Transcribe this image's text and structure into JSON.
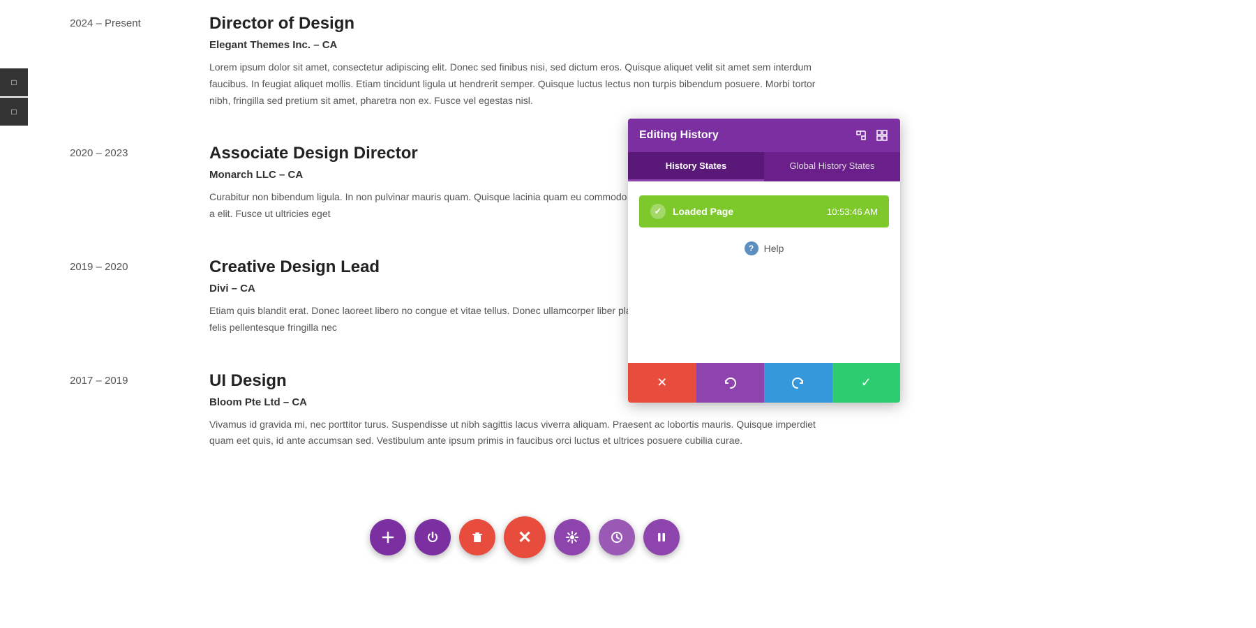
{
  "timeline": [
    {
      "years": "2024 – Present",
      "title": "Director of Design",
      "company": "Elegant Themes Inc. – CA",
      "description": "Lorem ipsum dolor sit amet, consectetur adipiscing elit. Donec sed finibus nisi, sed dictum eros. Quisque aliquet velit sit amet sem interdum faucibus. In feugiat aliquet mollis. Etiam tincidunt ligula ut hendrerit semper. Quisque luctus lectus non turpis bibendum posuere. Morbi tortor nibh, fringilla sed pretium sit amet, pharetra non ex. Fusce vel egestas nisl."
    },
    {
      "years": "2020 – 2023",
      "title": "Associate Design Director",
      "company": "Monarch LLC – CA",
      "description": "Curabitur non bibendum ligula. In non pulvinar mauris quam. Quisque lacinia quam eu commodo orci. Sed vitae nulla et justo pellentesque congu a elit. Fusce ut ultricies eget"
    },
    {
      "years": "2019 – 2020",
      "title": "Creative Design Lead",
      "company": "Divi – CA",
      "description": "Etiam quis blandit erat. Donec laoreet libero no congue et vitae tellus. Donec ullamcorper liber placerat eget, sollicitudin a sapien. Cras ut auct felis pellentesque fringilla nec"
    },
    {
      "years": "2017 – 2019",
      "title": "UI Design",
      "company": "Bloom Pte Ltd – CA",
      "description": "Vivamus id gravida mi, nec porttitor turus. Suspendisse ut nibh sagittis lacus viverra aliquam. Praesent ac lobortis mauris. Quisque imperdiet quam eet quis, id ante accumsan sed. Vestibulum ante ipsum primis in faucibus orci luctus et ultrices posuere cubilia curae."
    }
  ],
  "panel": {
    "title": "Editing History",
    "tabs": [
      {
        "label": "History States",
        "active": true
      },
      {
        "label": "Global History States",
        "active": false
      }
    ],
    "history_item": {
      "label": "Loaded Page",
      "time": "10:53:46 AM"
    },
    "help_text": "Help",
    "footer_buttons": [
      {
        "icon": "✕",
        "color": "red"
      },
      {
        "icon": "↺",
        "color": "purple"
      },
      {
        "icon": "↻",
        "color": "blue"
      },
      {
        "icon": "✓",
        "color": "green"
      }
    ]
  },
  "floating_toolbar": {
    "buttons": [
      {
        "icon": "+",
        "color": "purple-dark",
        "name": "add"
      },
      {
        "icon": "⏻",
        "color": "purple-dark",
        "name": "power"
      },
      {
        "icon": "🗑",
        "color": "red-btn",
        "name": "delete"
      },
      {
        "icon": "✕",
        "color": "close-btn",
        "name": "close"
      },
      {
        "icon": "⚙",
        "color": "settings-btn",
        "name": "settings"
      },
      {
        "icon": "🕐",
        "color": "history-btn",
        "name": "history"
      },
      {
        "icon": "⏸",
        "color": "pause-btn",
        "name": "pause"
      }
    ]
  },
  "sidebar": {
    "buttons": [
      "□",
      "□"
    ]
  }
}
